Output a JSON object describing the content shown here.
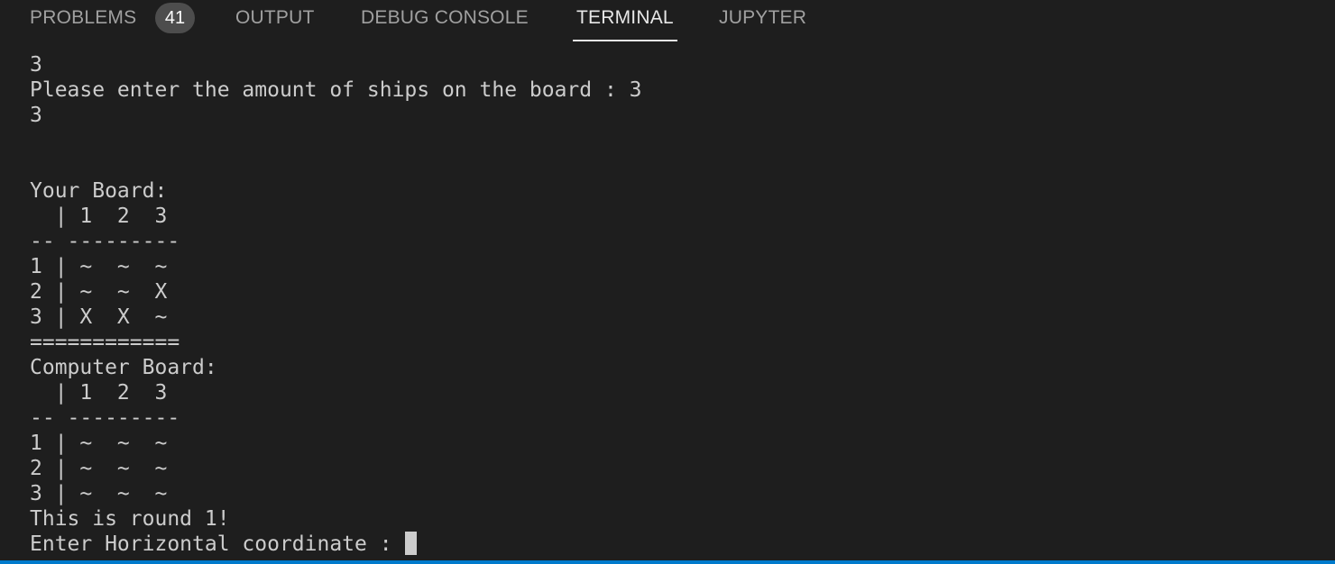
{
  "tabs": {
    "problems": {
      "label": "PROBLEMS",
      "badge": "41"
    },
    "output": {
      "label": "OUTPUT"
    },
    "debug_console": {
      "label": "DEBUG CONSOLE"
    },
    "terminal": {
      "label": "TERMINAL"
    },
    "jupyter": {
      "label": "JUPYTER"
    }
  },
  "terminal": {
    "lines": [
      "3",
      "Please enter the amount of ships on the board : 3",
      "3",
      "",
      "",
      "Your Board:",
      "  | 1  2  3",
      "-- ---------",
      "1 | ~  ~  ~",
      "2 | ~  ~  X",
      "3 | X  X  ~",
      "============",
      "Computer Board:",
      "  | 1  2  3",
      "-- ---------",
      "1 | ~  ~  ~",
      "2 | ~  ~  ~",
      "3 | ~  ~  ~",
      "This is round 1!",
      "Enter Horizontal coordinate : "
    ]
  },
  "colors": {
    "background": "#1e1e1e",
    "text": "#cccccc",
    "active_tab": "#e7e7e7",
    "inactive_tab": "#a0a0a0",
    "badge": "#4d4d4d",
    "status_bar": "#007acc"
  }
}
